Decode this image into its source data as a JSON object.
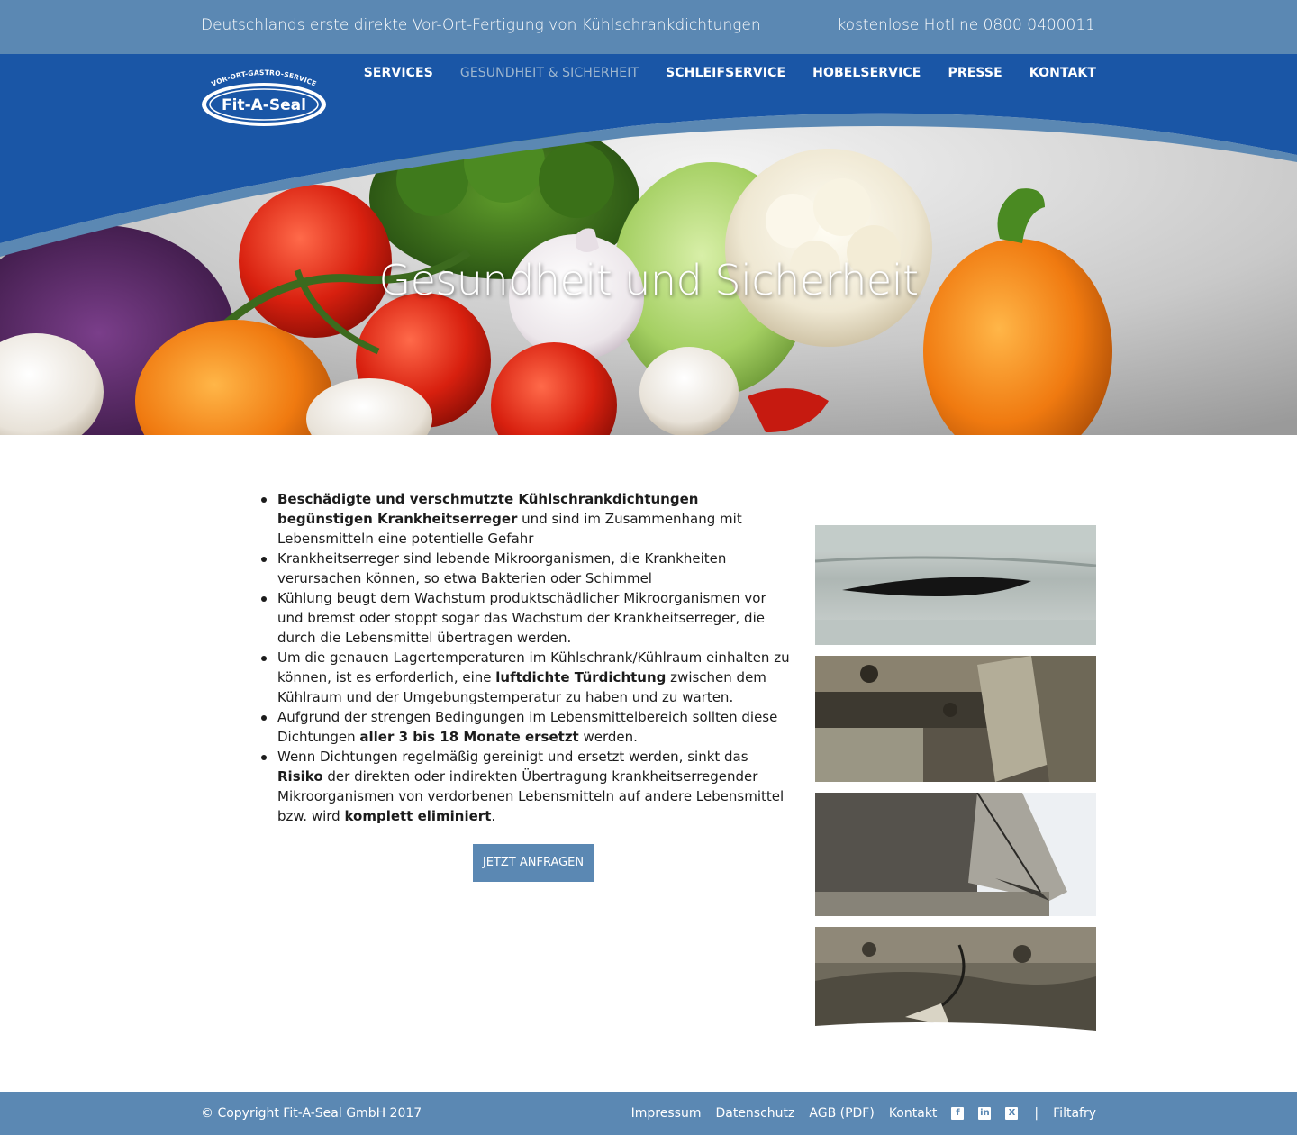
{
  "topbar": {
    "tagline": "Deutschlands erste direkte Vor-Ort-Fertigung von Kühlschrankdichtungen",
    "hotline": "kostenlose Hotline 0800 0400011"
  },
  "logo": {
    "arc_text": "VOR-ORT-GASTRO-SERVICE",
    "brand": "Fit-A-Seal"
  },
  "nav": {
    "items": [
      {
        "label": "SERVICES"
      },
      {
        "label": "GESUNDHEIT & SICHERHEIT"
      },
      {
        "label": "SCHLEIFSERVICE"
      },
      {
        "label": "HOBELSERVICE"
      },
      {
        "label": "PRESSE"
      },
      {
        "label": "KONTAKT"
      }
    ],
    "active_index": 1
  },
  "hero": {
    "title": "Gesundheit und Sicherheit"
  },
  "content": {
    "bullets": [
      {
        "parts": [
          {
            "text": "Beschädigte und verschmutzte Kühlschrankdichtungen begünstigen Krankheitserreger",
            "bold": true
          },
          {
            "text": " und sind im Zusammenhang mit Lebensmitteln eine potentielle Gefahr",
            "bold": false
          }
        ]
      },
      {
        "parts": [
          {
            "text": "Krankheitserreger sind lebende Mikroorganismen, die Krankheiten verursachen können, so etwa Bakterien oder Schimmel",
            "bold": false
          }
        ]
      },
      {
        "parts": [
          {
            "text": "Kühlung beugt dem Wachstum produktschädlicher Mikroorganismen vor und bremst oder stoppt sogar das Wachstum der Krankheitserreger, die durch die Lebensmittel übertragen werden.",
            "bold": false
          }
        ]
      },
      {
        "parts": [
          {
            "text": "Um die genauen Lagertemperaturen im Kühlschrank/Kühlraum einhalten zu können, ist es erforderlich, eine ",
            "bold": false
          },
          {
            "text": "luftdichte Türdichtung",
            "bold": true
          },
          {
            "text": " zwischen dem Kühlraum und der Umgebungstemperatur zu haben und zu warten.",
            "bold": false
          }
        ]
      },
      {
        "parts": [
          {
            "text": "Aufgrund der strengen Bedingungen im Lebensmittelbereich sollten diese Dichtungen ",
            "bold": false
          },
          {
            "text": "aller 3 bis 18 Monate ersetzt",
            "bold": true
          },
          {
            "text": " werden.",
            "bold": false
          }
        ]
      },
      {
        "parts": [
          {
            "text": "Wenn Dichtungen regelmäßig gereinigt und ersetzt werden, sinkt das ",
            "bold": false
          },
          {
            "text": "Risiko",
            "bold": true
          },
          {
            "text": " der direkten oder indirekten Übertragung krankheitserregender Mikroorganismen von verdorbenen Lebensmitteln auf andere Lebensmittel bzw. wird ",
            "bold": false
          },
          {
            "text": "komplett eliminiert",
            "bold": true
          },
          {
            "text": ".",
            "bold": false
          }
        ]
      }
    ],
    "cta_label": "JETZT ANFRAGEN"
  },
  "gallery": {
    "images": [
      {
        "name": "gallery-image-cracked-seal"
      },
      {
        "name": "gallery-image-dirty-corner"
      },
      {
        "name": "gallery-image-torn-corner"
      },
      {
        "name": "gallery-image-moldy-seal"
      }
    ]
  },
  "footer": {
    "copyright": "© Copyright Fit-A-Seal GmbH 2017",
    "links": [
      "Impressum",
      "Datenschutz",
      "AGB (PDF)",
      "Kontakt"
    ],
    "social": [
      {
        "icon": "facebook-icon",
        "glyph": "f"
      },
      {
        "icon": "linkedin-icon",
        "glyph": "in"
      },
      {
        "icon": "xing-icon",
        "glyph": "X"
      }
    ],
    "separator": "|",
    "extra_link": "Filtafry"
  },
  "colors": {
    "topbar": "#5b88b3",
    "header_blue": "#1a56a6",
    "accent": "#5b88b3",
    "footer": "#5b88b3"
  }
}
